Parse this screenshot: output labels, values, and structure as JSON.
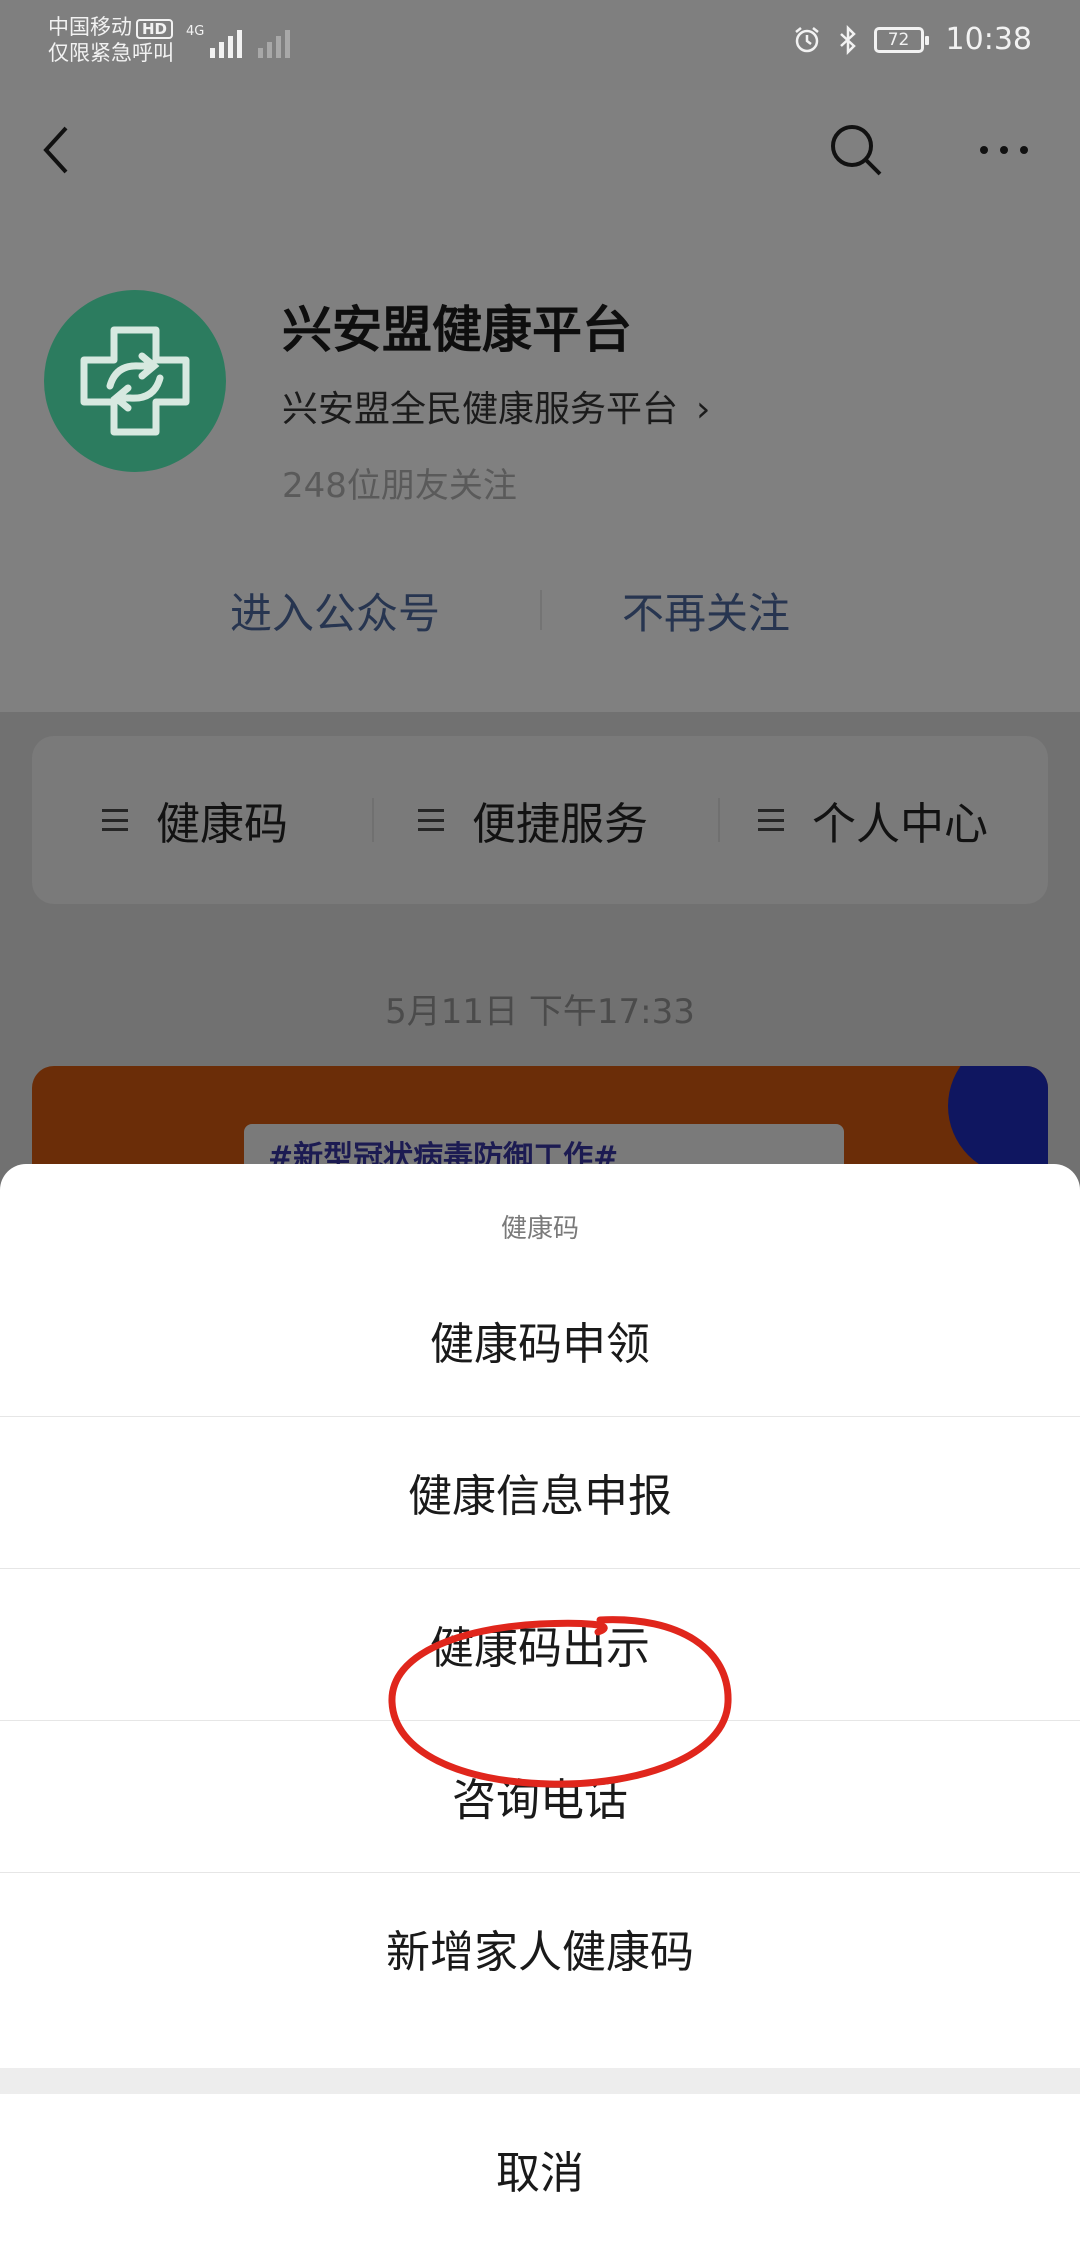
{
  "status_bar": {
    "carrier": "中国移动",
    "hd": "HD",
    "emergency": "仅限紧急呼叫",
    "network": "4G",
    "battery": "72",
    "time": "10:38"
  },
  "account": {
    "name": "兴安盟健康平台",
    "subtitle": "兴安盟全民健康服务平台",
    "followers": "248位朋友关注",
    "enter_label": "进入公众号",
    "unfollow_label": "不再关注"
  },
  "menu": {
    "items": [
      {
        "label": "健康码"
      },
      {
        "label": "便捷服务"
      },
      {
        "label": "个人中心"
      }
    ]
  },
  "feed": {
    "date": "5月11日 下午17:33",
    "banner_text": "#新型冠状病毒防御工作#"
  },
  "sheet": {
    "title": "健康码",
    "options": [
      {
        "label": "健康码申领"
      },
      {
        "label": "健康信息申报"
      },
      {
        "label": "健康码出示"
      },
      {
        "label": "咨询电话"
      },
      {
        "label": "新增家人健康码"
      }
    ],
    "cancel": "取消"
  },
  "colors": {
    "annotation_circle": "#e0261c",
    "avatar_bg": "#2c7c5f",
    "dimmed_overlay": "#808080"
  }
}
